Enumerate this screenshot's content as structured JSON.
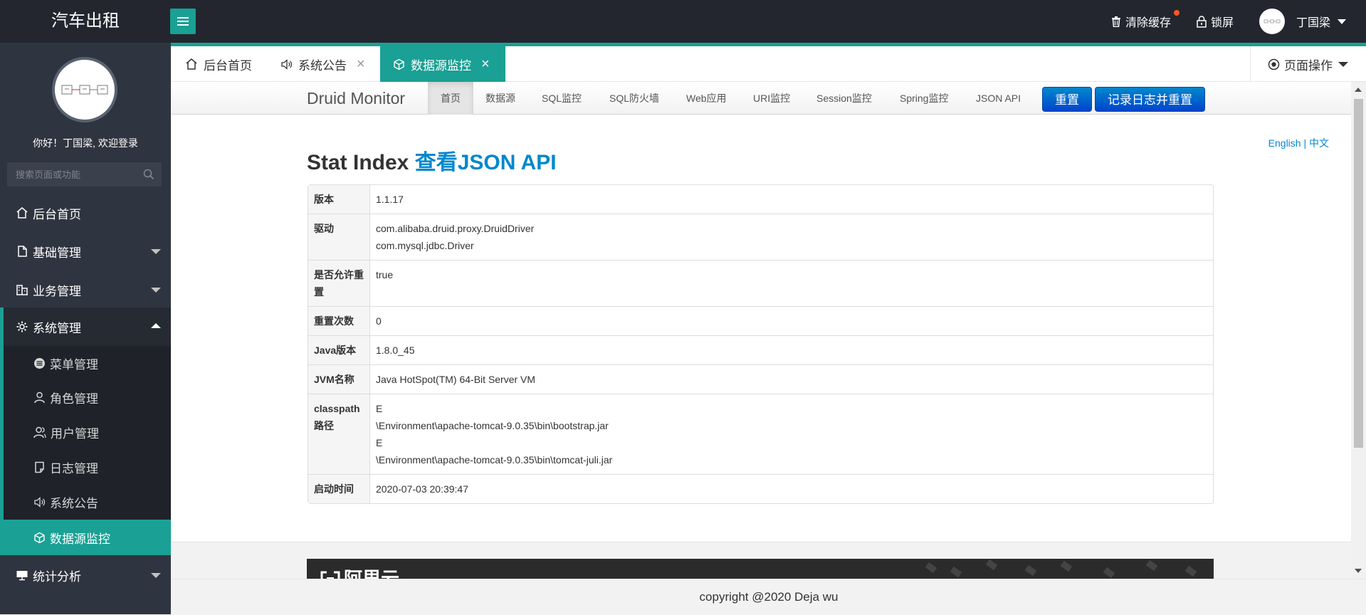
{
  "app": {
    "title": "汽车出租"
  },
  "topbar": {
    "clear_cache": "清除缓存",
    "lock_screen": "锁屏",
    "username": "丁国梁",
    "accent_color": "#1aa094"
  },
  "sidebar": {
    "welcome": "你好！丁国梁, 欢迎登录",
    "search_placeholder": "搜索页面或功能",
    "items": [
      {
        "label": "后台首页",
        "icon": "home-icon"
      },
      {
        "label": "基础管理",
        "icon": "file-icon"
      },
      {
        "label": "业务管理",
        "icon": "building-icon"
      },
      {
        "label": "系统管理",
        "icon": "gear-icon"
      },
      {
        "label": "统计分析",
        "icon": "monitor-icon"
      }
    ],
    "subitems": [
      {
        "label": "菜单管理",
        "icon": "circle-menu-icon"
      },
      {
        "label": "角色管理",
        "icon": "user-icon"
      },
      {
        "label": "用户管理",
        "icon": "users-icon"
      },
      {
        "label": "日志管理",
        "icon": "note-icon"
      },
      {
        "label": "系统公告",
        "icon": "speaker-icon"
      },
      {
        "label": "数据源监控",
        "icon": "cube-icon",
        "active": true
      }
    ]
  },
  "tabs": [
    {
      "label": "后台首页",
      "icon": "home-icon"
    },
    {
      "label": "系统公告",
      "icon": "speaker-icon",
      "closable": true
    },
    {
      "label": "数据源监控",
      "icon": "cube-icon",
      "closable": true,
      "active": true
    }
  ],
  "page_ops": "页面操作",
  "druid": {
    "brand": "Druid Monitor",
    "nav": [
      "首页",
      "数据源",
      "SQL监控",
      "SQL防火墙",
      "Web应用",
      "URI监控",
      "Session监控",
      "Spring监控",
      "JSON API"
    ],
    "buttons": [
      "重置",
      "记录日志并重置"
    ],
    "lang": {
      "en": "English",
      "sep": "|",
      "zh": "中文"
    },
    "title": "Stat Index",
    "title_link": "查看JSON API",
    "rows": [
      {
        "key": "版本",
        "lines": [
          "1.1.17"
        ]
      },
      {
        "key": "驱动",
        "lines": [
          "com.alibaba.druid.proxy.DruidDriver",
          "com.mysql.jdbc.Driver"
        ]
      },
      {
        "key": "是否允许重置",
        "lines": [
          "true"
        ]
      },
      {
        "key": "重置次数",
        "lines": [
          "0"
        ]
      },
      {
        "key": "Java版本",
        "lines": [
          "1.8.0_45"
        ]
      },
      {
        "key": "JVM名称",
        "lines": [
          "Java HotSpot(TM) 64-Bit Server VM"
        ]
      },
      {
        "key": "classpath路径",
        "lines": [
          "E",
          "\\Environment\\apache-tomcat-9.0.35\\bin\\bootstrap.jar",
          "E",
          "\\Environment\\apache-tomcat-9.0.35\\bin\\tomcat-juli.jar"
        ]
      },
      {
        "key": "启动时间",
        "lines": [
          "2020-07-03 20:39:47"
        ]
      }
    ],
    "banner_text": "阿里云"
  },
  "footer": "copyright @2020 Deja wu"
}
